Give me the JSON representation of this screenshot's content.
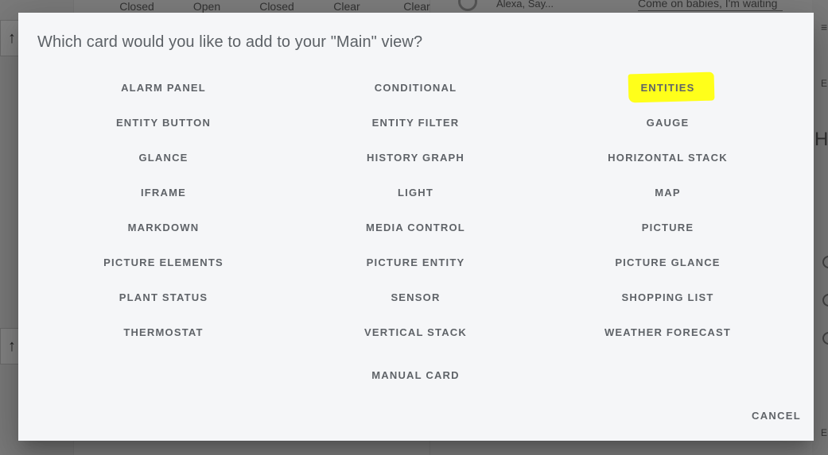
{
  "background": {
    "status_row": [
      "Closed",
      "Open",
      "Closed",
      "Clear",
      "Clear"
    ],
    "sensor_label": "Alexa, Say...",
    "input_value": "Come on babies, I'm waiting",
    "right_letter": "H",
    "right_button_label": "E"
  },
  "dialog": {
    "title": "Which card would you like to add to your \"Main\" view?",
    "cards": [
      "ALARM PANEL",
      "CONDITIONAL",
      "ENTITIES",
      "ENTITY BUTTON",
      "ENTITY FILTER",
      "GAUGE",
      "GLANCE",
      "HISTORY GRAPH",
      "HORIZONTAL STACK",
      "IFRAME",
      "LIGHT",
      "MAP",
      "MARKDOWN",
      "MEDIA CONTROL",
      "PICTURE",
      "PICTURE ELEMENTS",
      "PICTURE ENTITY",
      "PICTURE GLANCE",
      "PLANT STATUS",
      "SENSOR",
      "SHOPPING LIST",
      "THERMOSTAT",
      "VERTICAL STACK",
      "WEATHER FORECAST"
    ],
    "manual_card": "MANUAL CARD",
    "cancel_label": "CANCEL",
    "highlight_color": "#ffff1a",
    "highlighted_card": "ENTITIES"
  }
}
